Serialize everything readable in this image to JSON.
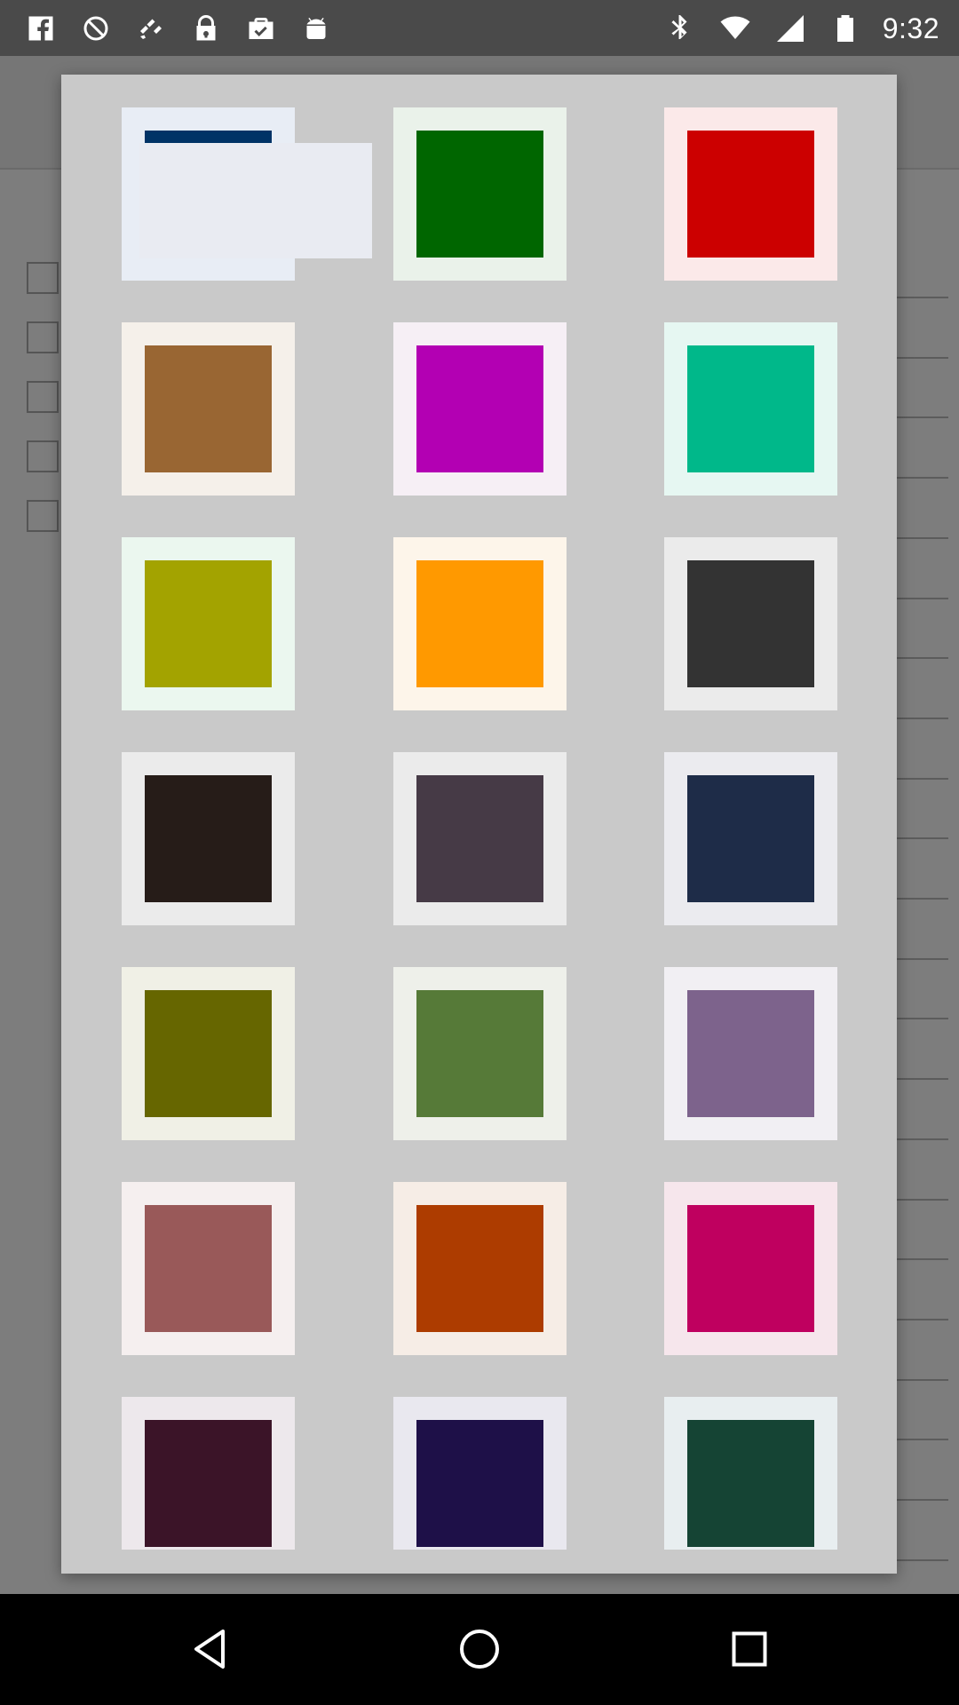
{
  "status_bar": {
    "time": "9:32",
    "left_icons": [
      "facebook-icon",
      "blocked-icon",
      "fake-gps-icon",
      "lock-icon",
      "briefcase-check-icon",
      "android-icon"
    ],
    "right_icons": [
      "bluetooth-icon",
      "wifi-icon",
      "signal-icon",
      "battery-icon"
    ]
  },
  "color_picker": {
    "selected_index": 0,
    "swatches": [
      {
        "name": "swatch-navy",
        "color": "#003366",
        "frame": "#e8edf5"
      },
      {
        "name": "swatch-green",
        "color": "#006600",
        "frame": "#eaf2ea"
      },
      {
        "name": "swatch-red",
        "color": "#cc0000",
        "frame": "#fbe9e9"
      },
      {
        "name": "swatch-brown",
        "color": "#996633",
        "frame": "#f5f0ea"
      },
      {
        "name": "swatch-magenta",
        "color": "#b300b3",
        "frame": "#f6eff5"
      },
      {
        "name": "swatch-teal",
        "color": "#00b88a",
        "frame": "#e6f7f2"
      },
      {
        "name": "swatch-olive-yellow",
        "color": "#a3a300",
        "frame": "#ebf7ef"
      },
      {
        "name": "swatch-orange",
        "color": "#ff9900",
        "frame": "#fdf5ea"
      },
      {
        "name": "swatch-charcoal",
        "color": "#333333",
        "frame": "#ebebeb"
      },
      {
        "name": "swatch-dark-brown",
        "color": "#261c18",
        "frame": "#ebebeb"
      },
      {
        "name": "swatch-plum-gray",
        "color": "#463a46",
        "frame": "#ebebeb"
      },
      {
        "name": "swatch-dark-navy",
        "color": "#1e2c48",
        "frame": "#ebebef"
      },
      {
        "name": "swatch-olive",
        "color": "#666600",
        "frame": "#f0f0e6"
      },
      {
        "name": "swatch-moss",
        "color": "#567a38",
        "frame": "#eef0ea"
      },
      {
        "name": "swatch-lavender",
        "color": "#7d638c",
        "frame": "#f1eff3"
      },
      {
        "name": "swatch-rose",
        "color": "#995959",
        "frame": "#f5efef"
      },
      {
        "name": "swatch-rust",
        "color": "#ad3c00",
        "frame": "#f6ede6"
      },
      {
        "name": "swatch-crimson",
        "color": "#bf005f",
        "frame": "#f6e6ec"
      },
      {
        "name": "swatch-aubergine",
        "color": "#3b1428",
        "frame": "#ede8ec"
      },
      {
        "name": "swatch-indigo",
        "color": "#1e1048",
        "frame": "#e9e8ef"
      },
      {
        "name": "swatch-forest",
        "color": "#154434",
        "frame": "#e8eef0"
      }
    ]
  },
  "nav_bar": {
    "buttons": [
      "back-icon",
      "home-icon",
      "recents-icon"
    ]
  }
}
